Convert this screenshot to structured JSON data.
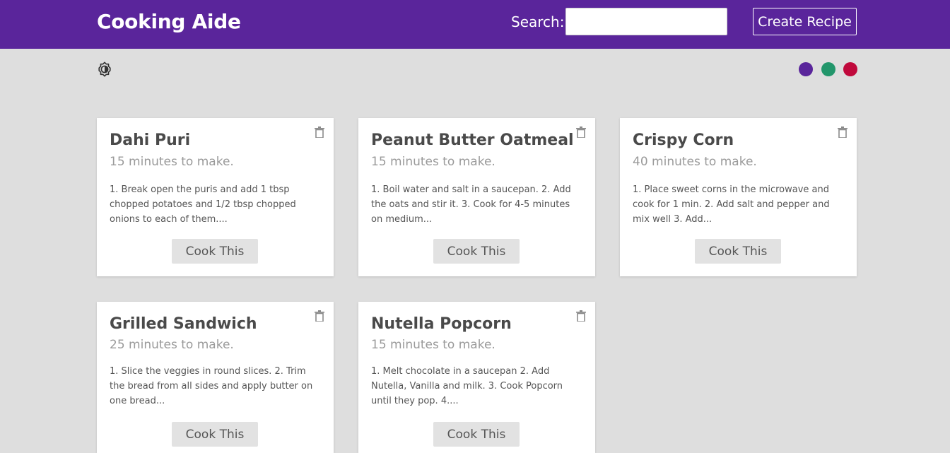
{
  "header": {
    "brand": "Cooking Aide",
    "search_label": "Search:",
    "search_value": "",
    "search_placeholder": "",
    "create_label": "Create Recipe",
    "background_color": "#5a259b"
  },
  "toolbar": {
    "theme_icon": "brightness-icon",
    "color_swatches": [
      {
        "name": "purple",
        "color": "#5a259b"
      },
      {
        "name": "green",
        "color": "#22966b"
      },
      {
        "name": "red",
        "color": "#c0093c"
      }
    ]
  },
  "recipes": [
    {
      "title": "Dahi Puri",
      "time": "15 minutes to make.",
      "description": "1. Break open the puris and add 1 tbsp chopped potatoes and 1/2 tbsp chopped onions to each of them....",
      "cook_label": "Cook This"
    },
    {
      "title": "Peanut Butter Oatmeal",
      "time": "15 minutes to make.",
      "description": "1. Boil water and salt in a saucepan. 2. Add the oats and stir it. 3. Cook for 4-5 minutes on medium...",
      "cook_label": "Cook This"
    },
    {
      "title": "Crispy Corn",
      "time": "40 minutes to make.",
      "description": "1. Place sweet corns in the microwave and cook for 1 min. 2. Add salt and pepper and mix well 3. Add...",
      "cook_label": "Cook This"
    },
    {
      "title": "Grilled Sandwich",
      "time": "25 minutes to make.",
      "description": "1. Slice the veggies in round slices. 2. Trim the bread from all sides and apply butter on one bread...",
      "cook_label": "Cook This"
    },
    {
      "title": "Nutella Popcorn",
      "time": "15 minutes to make.",
      "description": "1. Melt chocolate in a saucepan 2. Add Nutella, Vanilla and milk. 3. Cook Popcorn until they pop. 4....",
      "cook_label": "Cook This"
    }
  ]
}
